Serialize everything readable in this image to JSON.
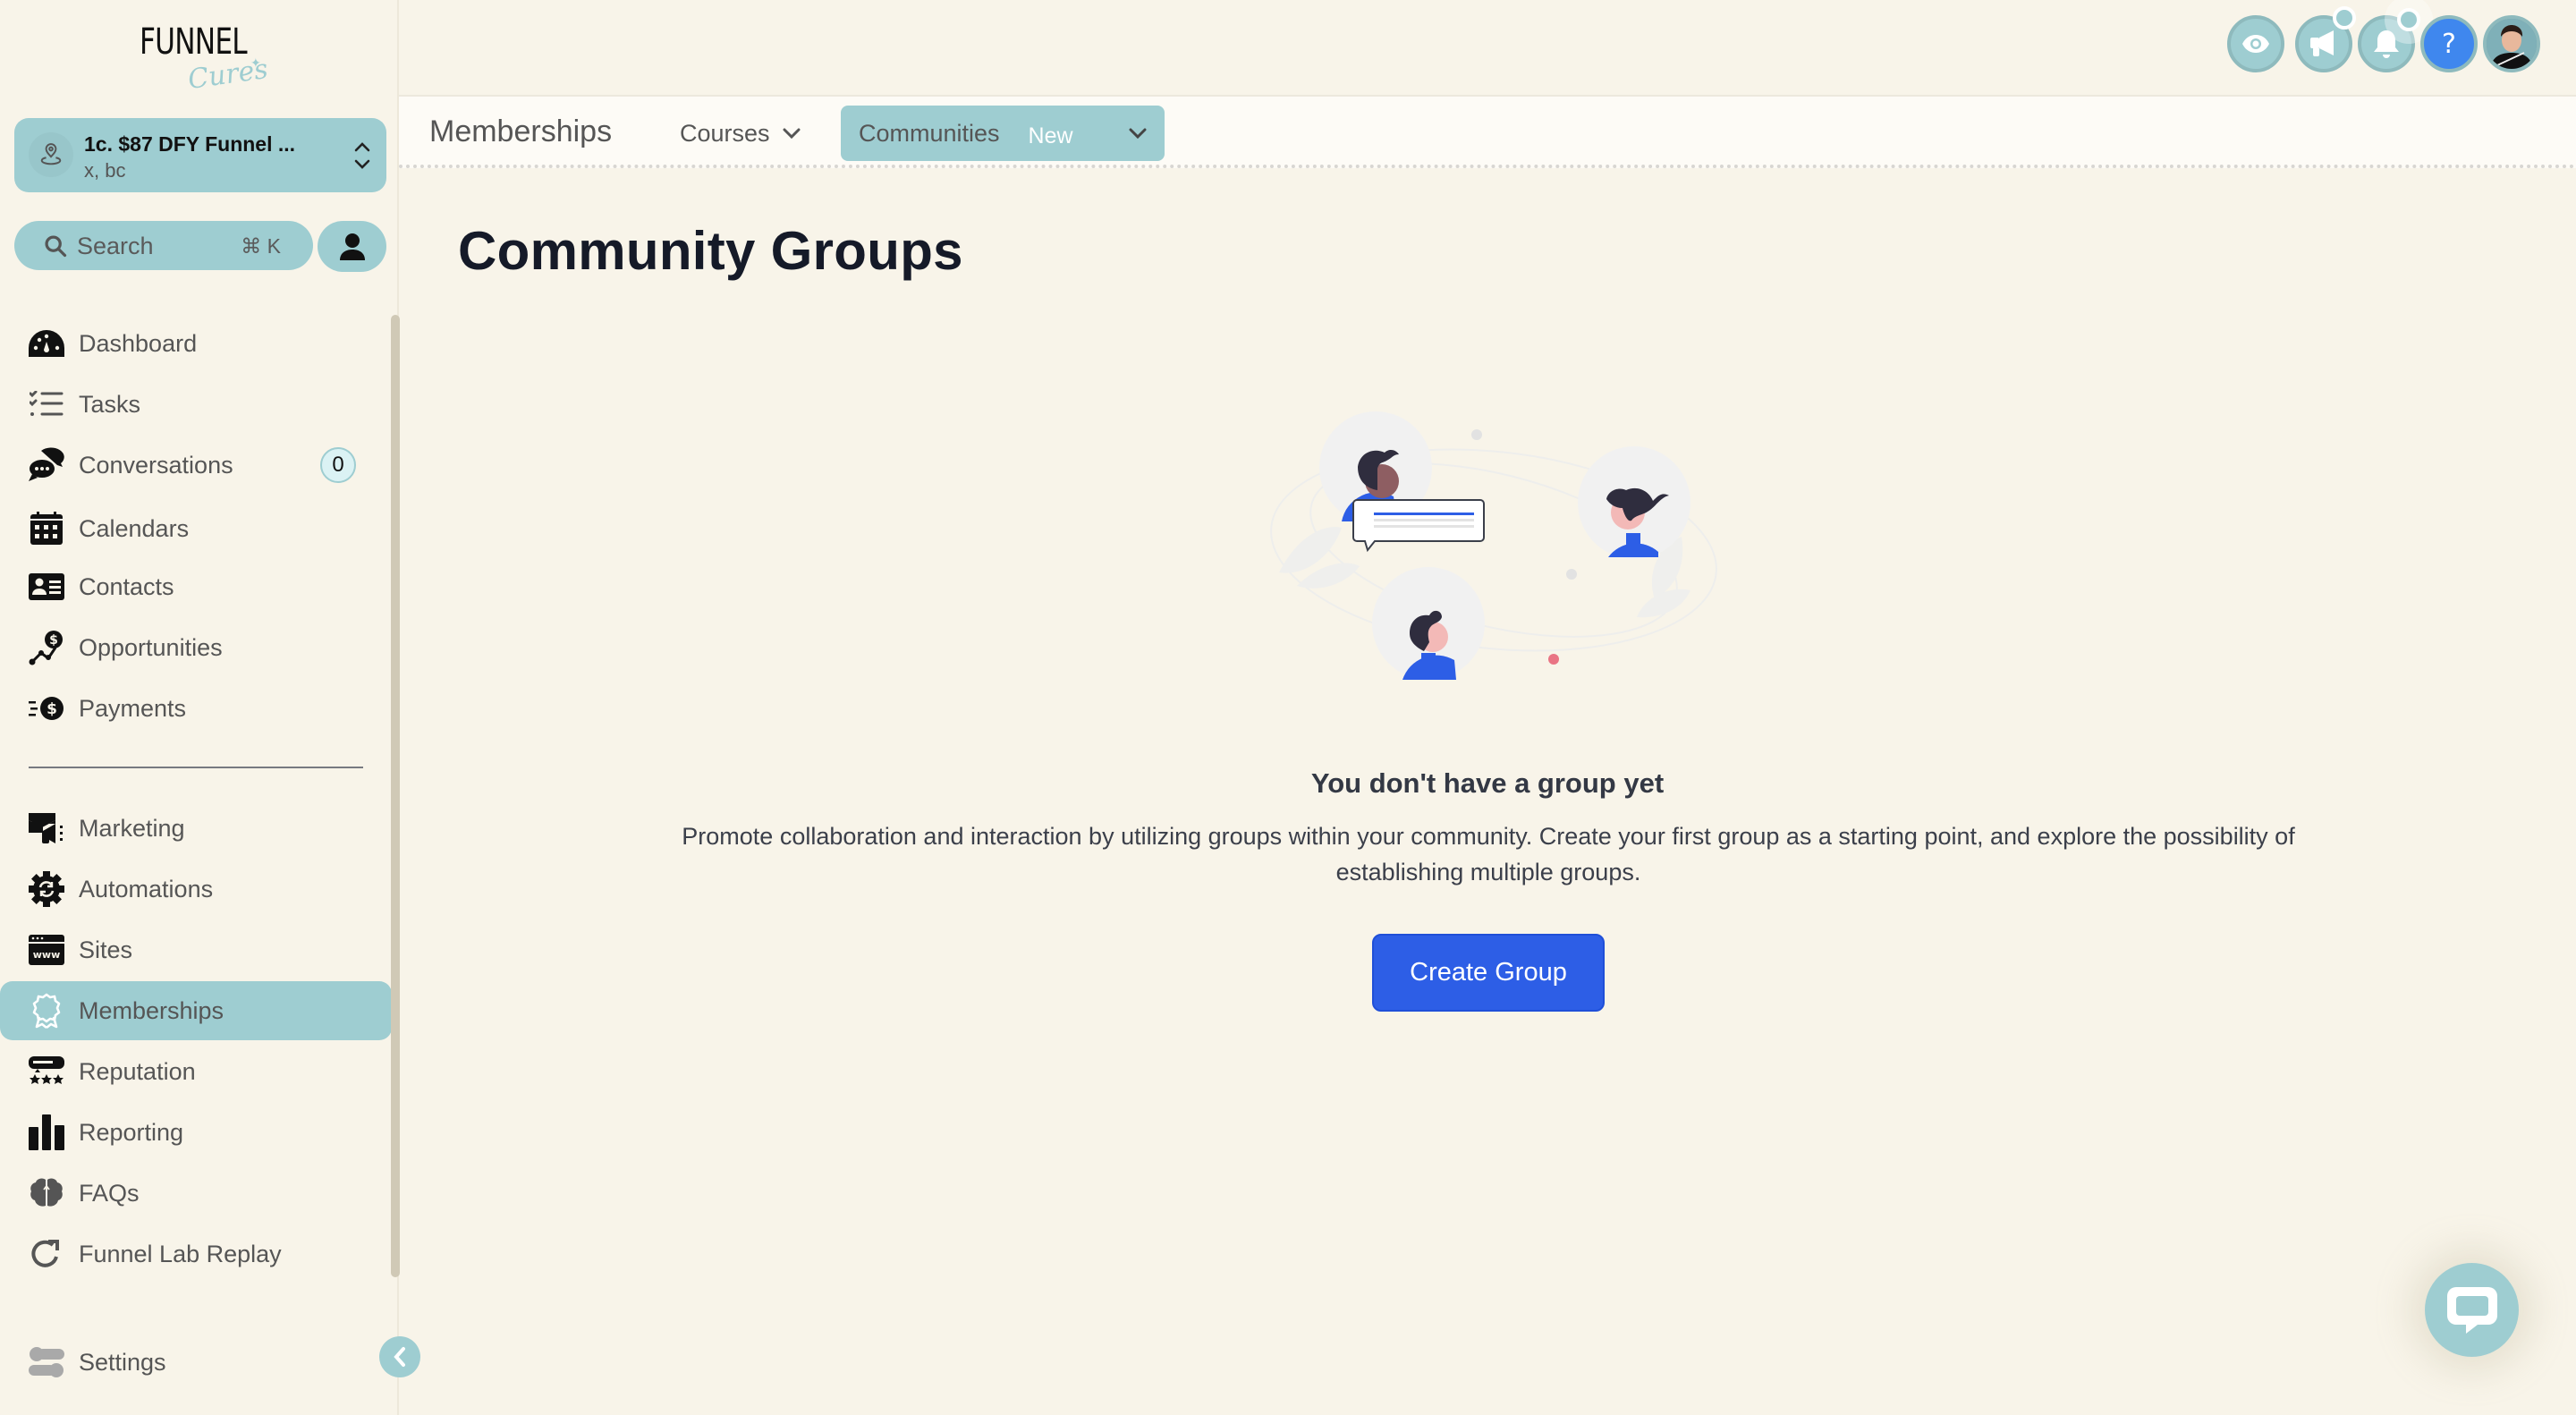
{
  "brand": {
    "logo_word": "FUNNEL",
    "logo_script": "Cures"
  },
  "account": {
    "name": "1c. $87 DFY Funnel ...",
    "subtitle": "x, bc"
  },
  "search": {
    "placeholder": "Search",
    "shortcut": "⌘ K"
  },
  "sidebar": {
    "items": [
      {
        "label": "Dashboard",
        "icon": "dashboard-icon"
      },
      {
        "label": "Tasks",
        "icon": "tasks-icon"
      },
      {
        "label": "Conversations",
        "icon": "conversations-icon",
        "badge": "0"
      },
      {
        "label": "Calendars",
        "icon": "calendar-icon"
      },
      {
        "label": "Contacts",
        "icon": "contacts-icon"
      },
      {
        "label": "Opportunities",
        "icon": "opportunities-icon"
      },
      {
        "label": "Payments",
        "icon": "payments-icon"
      },
      {
        "label": "Marketing",
        "icon": "marketing-icon"
      },
      {
        "label": "Automations",
        "icon": "automations-icon"
      },
      {
        "label": "Sites",
        "icon": "sites-icon"
      },
      {
        "label": "Memberships",
        "icon": "memberships-icon",
        "active": true
      },
      {
        "label": "Reputation",
        "icon": "reputation-icon"
      },
      {
        "label": "Reporting",
        "icon": "reporting-icon"
      },
      {
        "label": "FAQs",
        "icon": "brain-icon"
      },
      {
        "label": "Funnel Lab Replay",
        "icon": "replay-icon"
      }
    ],
    "settings_label": "Settings"
  },
  "topbar": {
    "icons": [
      "eye-icon",
      "megaphone-icon",
      "bell-icon",
      "help-icon",
      "user-avatar"
    ],
    "help_glyph": "?"
  },
  "subnav": {
    "title": "Memberships",
    "tabs": [
      {
        "label": "Courses"
      },
      {
        "label": "Communities",
        "badge": "New",
        "active": true
      }
    ]
  },
  "main": {
    "title": "Community Groups",
    "empty_heading": "You don't have a group yet",
    "empty_text": "Promote collaboration and interaction by utilizing groups within your community. Create your first group as a starting point, and explore the possibility of establishing multiple groups.",
    "create_button": "Create Group"
  },
  "colors": {
    "accent": "#9ecdd1",
    "primary": "#2d5ee6",
    "background": "#f8f4e9",
    "help": "#3f87ee"
  }
}
